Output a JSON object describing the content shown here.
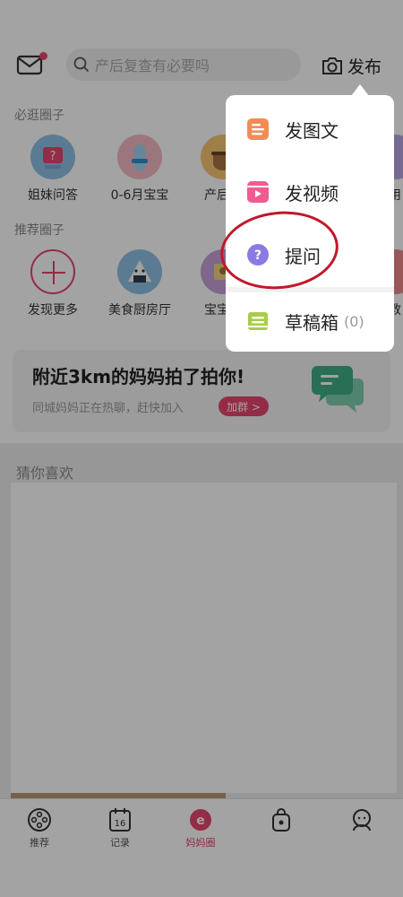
{
  "header": {
    "search_placeholder": "产后复查有必要吗",
    "publish_label": "发布"
  },
  "must_visit": {
    "title": "必逛圈子",
    "items": [
      {
        "label": "姐妹问答"
      },
      {
        "label": "0-6月宝宝"
      },
      {
        "label": "产后调"
      },
      {
        "label": "用"
      }
    ]
  },
  "recommended": {
    "title": "推荐圈子",
    "items": [
      {
        "label": "发现更多"
      },
      {
        "label": "美食厨房厅"
      },
      {
        "label": "宝宝晒"
      },
      {
        "label": "教"
      }
    ]
  },
  "banner": {
    "title": "附近3km的妈妈拍了拍你!",
    "subtitle": "同城妈妈正在热聊，赶快加入",
    "button": "加群 >"
  },
  "feed": {
    "title": "猜你喜欢"
  },
  "tabbar": {
    "tabs": [
      {
        "label": "推荐",
        "icon": "film-reel-icon"
      },
      {
        "label": "记录",
        "icon": "calendar-icon"
      },
      {
        "label": "妈妈圈",
        "icon": "circle-e-icon"
      },
      {
        "label": "",
        "icon": "bag-icon"
      },
      {
        "label": "",
        "icon": "person-icon"
      }
    ]
  },
  "popup_menu": {
    "items": [
      {
        "label": "发图文",
        "icon": "image-text-icon"
      },
      {
        "label": "发视频",
        "icon": "video-icon"
      },
      {
        "label": "提问",
        "icon": "question-icon"
      },
      {
        "label": "草稿箱",
        "count": "(0)",
        "icon": "drafts-icon"
      }
    ]
  },
  "colors": {
    "accent": "#e7456e",
    "annotation_red": "#c0182b"
  }
}
